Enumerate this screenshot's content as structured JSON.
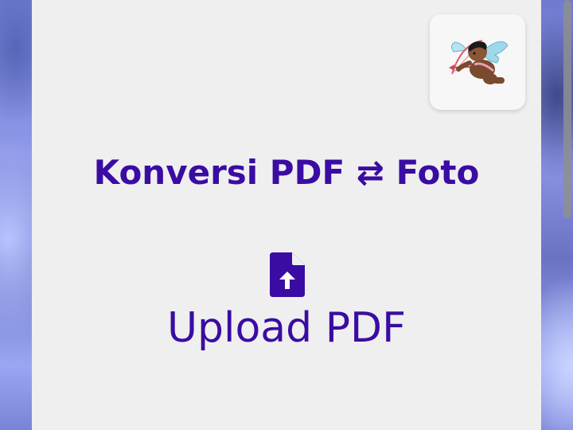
{
  "header": {
    "title": "Konversi PDF ⇄ Foto",
    "avatar_icon": "cupid-icon"
  },
  "upload": {
    "icon": "file-upload-icon",
    "label": "Upload PDF"
  },
  "colors": {
    "accent": "#3a0ca3",
    "card_background": "#efefef"
  }
}
